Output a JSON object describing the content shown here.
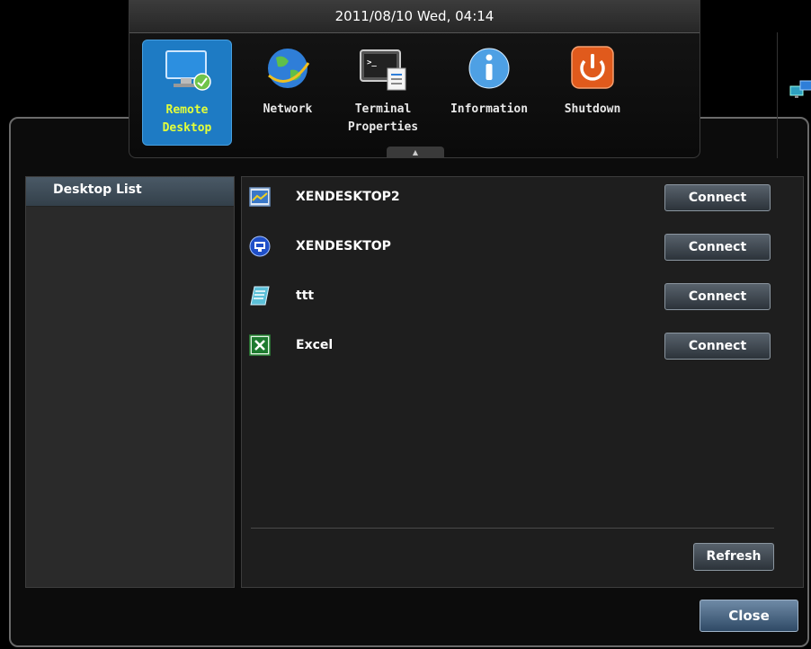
{
  "header": {
    "datetime": "2011/08/10 Wed, 04:14"
  },
  "toolbar": {
    "items": [
      {
        "label": "Remote\nDesktop",
        "icon": "remote-desktop-icon",
        "active": true
      },
      {
        "label": "Network",
        "icon": "globe-icon",
        "active": false
      },
      {
        "label": "Terminal\nProperties",
        "icon": "terminal-icon",
        "active": false
      },
      {
        "label": "Information",
        "icon": "info-icon",
        "active": false
      },
      {
        "label": "Shutdown",
        "icon": "power-icon",
        "active": false
      }
    ],
    "extra_icon": "network-computers-icon",
    "collapse_glyph": "▲"
  },
  "left_panel": {
    "title": "Desktop List"
  },
  "desktops": [
    {
      "name": "XENDESKTOP2",
      "icon": "desktop-chart-icon",
      "action": "Connect"
    },
    {
      "name": "XENDESKTOP",
      "icon": "xen-desktop-icon",
      "action": "Connect"
    },
    {
      "name": "ttt",
      "icon": "notepad-icon",
      "action": "Connect"
    },
    {
      "name": "Excel",
      "icon": "excel-icon",
      "action": "Connect"
    }
  ],
  "buttons": {
    "refresh": "Refresh",
    "close": "Close"
  },
  "colors": {
    "accent": "#1e7bc4",
    "active_label": "#e3ff3a",
    "background": "#000000"
  }
}
